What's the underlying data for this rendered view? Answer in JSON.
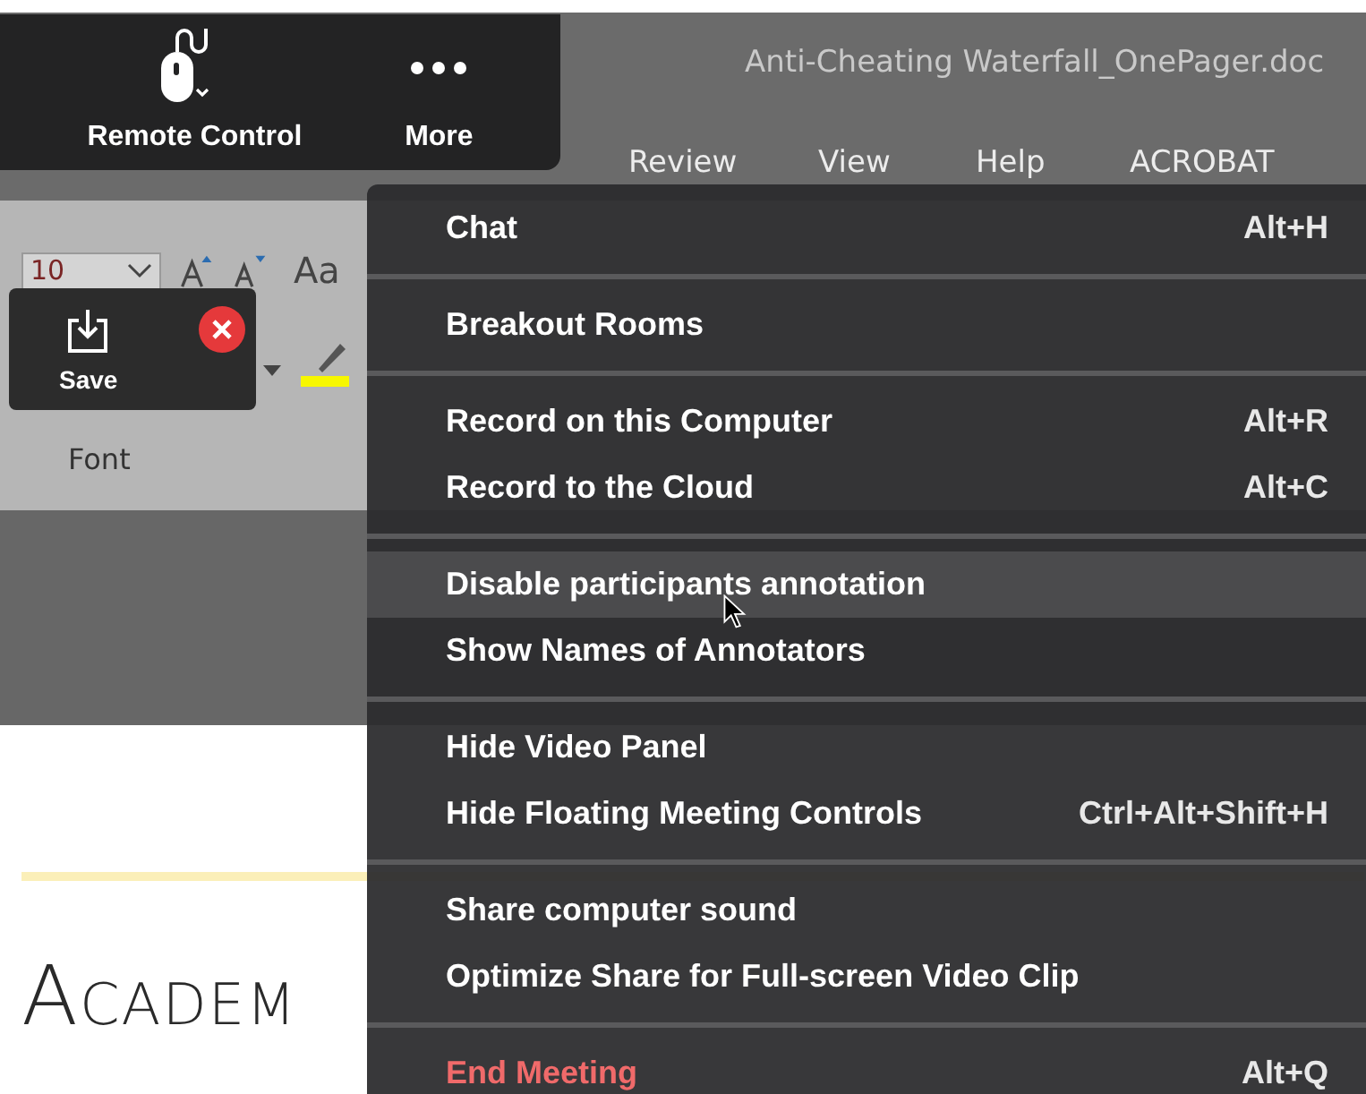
{
  "window": {
    "title": "Anti-Cheating Waterfall_OnePager.doc"
  },
  "ribbon_tabs": [
    "Review",
    "View",
    "Help",
    "ACROBAT"
  ],
  "ribbon": {
    "font_size": "10",
    "change_case": "Aa",
    "group_label": "Font"
  },
  "document": {
    "heading": "Academ"
  },
  "meeting_toolbar": [
    {
      "kind": "remote",
      "label": "Remote Control"
    },
    {
      "kind": "more",
      "label": "More"
    }
  ],
  "save_panel": {
    "label": "Save"
  },
  "menu": {
    "groups": [
      [
        {
          "label": "Chat",
          "shortcut": "Alt+H",
          "kind": "normal",
          "hovered": false
        }
      ],
      [
        {
          "label": "Breakout Rooms",
          "kind": "normal",
          "hovered": false
        }
      ],
      [
        {
          "label": "Record on this Computer",
          "shortcut": "Alt+R",
          "kind": "normal",
          "hovered": false
        },
        {
          "label": "Record to the Cloud",
          "shortcut": "Alt+C",
          "kind": "normal",
          "hovered": false
        }
      ],
      [
        {
          "label": "Disable participants annotation",
          "kind": "normal",
          "hovered": true
        },
        {
          "label": "Show Names of Annotators",
          "kind": "normal",
          "hovered": false
        }
      ],
      [
        {
          "label": "Hide Video Panel",
          "kind": "normal",
          "hovered": false
        },
        {
          "label": "Hide Floating Meeting Controls",
          "shortcut": "Ctrl+Alt+Shift+H",
          "kind": "normal",
          "hovered": false
        }
      ],
      [
        {
          "label": "Share computer sound",
          "kind": "normal",
          "hovered": false
        },
        {
          "label": "Optimize Share for Full-screen Video Clip",
          "kind": "normal",
          "hovered": false
        }
      ],
      [
        {
          "label": "End Meeting",
          "shortcut": "Alt+Q",
          "kind": "danger",
          "hovered": false
        }
      ]
    ]
  }
}
